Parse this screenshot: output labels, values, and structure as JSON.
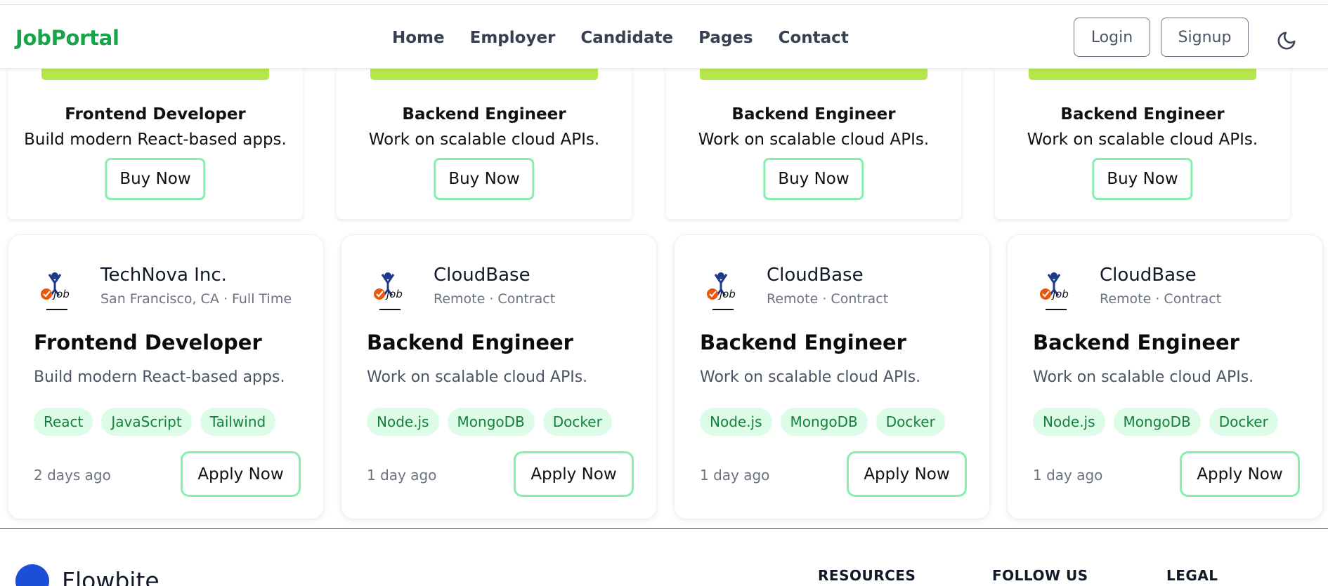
{
  "nav": {
    "brand": "JobPortal",
    "links": [
      "Home",
      "Employer",
      "Candidate",
      "Pages",
      "Contact"
    ],
    "login": "Login",
    "signup": "Signup",
    "theme_icon": "moon-icon"
  },
  "product_cards": [
    {
      "title": "Frontend Developer",
      "desc": "Build modern React-based apps.",
      "button": "Buy Now"
    },
    {
      "title": "Backend Engineer",
      "desc": "Work on scalable cloud APIs.",
      "button": "Buy Now"
    },
    {
      "title": "Backend Engineer",
      "desc": "Work on scalable cloud APIs.",
      "button": "Buy Now"
    },
    {
      "title": "Backend Engineer",
      "desc": "Work on scalable cloud APIs.",
      "button": "Buy Now"
    }
  ],
  "job_cards": [
    {
      "company": "TechNova Inc.",
      "meta": "San Francisco, CA · Full Time",
      "title": "Frontend Developer",
      "desc": "Build modern React-based apps.",
      "tags": [
        "React",
        "JavaScript",
        "Tailwind"
      ],
      "posted": "2 days ago",
      "button": "Apply Now"
    },
    {
      "company": "CloudBase",
      "meta": "Remote · Contract",
      "title": "Backend Engineer",
      "desc": "Work on scalable cloud APIs.",
      "tags": [
        "Node.js",
        "MongoDB",
        "Docker"
      ],
      "posted": "1 day ago",
      "button": "Apply Now"
    },
    {
      "company": "CloudBase",
      "meta": "Remote · Contract",
      "title": "Backend Engineer",
      "desc": "Work on scalable cloud APIs.",
      "tags": [
        "Node.js",
        "MongoDB",
        "Docker"
      ],
      "posted": "1 day ago",
      "button": "Apply Now"
    },
    {
      "company": "CloudBase",
      "meta": "Remote · Contract",
      "title": "Backend Engineer",
      "desc": "Work on scalable cloud APIs.",
      "tags": [
        "Node.js",
        "MongoDB",
        "Docker"
      ],
      "posted": "1 day ago",
      "button": "Apply Now"
    }
  ],
  "footer": {
    "brand": "Flowbite",
    "headings": [
      "RESOURCES",
      "FOLLOW US",
      "LEGAL"
    ]
  },
  "colors": {
    "brand": "#16a34a",
    "accent_bar": "#b5e64b",
    "button_border": "#86efac",
    "tag_bg": "#dcfce7",
    "tag_text": "#15803d"
  }
}
